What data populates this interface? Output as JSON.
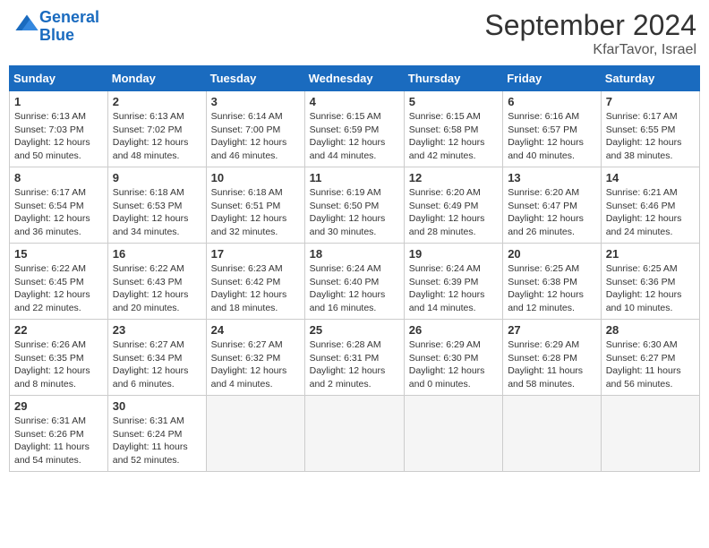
{
  "header": {
    "logo_general": "General",
    "logo_blue": "Blue",
    "title": "September 2024",
    "subtitle": "KfarTavor, Israel"
  },
  "calendar": {
    "days_of_week": [
      "Sunday",
      "Monday",
      "Tuesday",
      "Wednesday",
      "Thursday",
      "Friday",
      "Saturday"
    ],
    "weeks": [
      [
        {
          "day": "1",
          "info": "Sunrise: 6:13 AM\nSunset: 7:03 PM\nDaylight: 12 hours\nand 50 minutes."
        },
        {
          "day": "2",
          "info": "Sunrise: 6:13 AM\nSunset: 7:02 PM\nDaylight: 12 hours\nand 48 minutes."
        },
        {
          "day": "3",
          "info": "Sunrise: 6:14 AM\nSunset: 7:00 PM\nDaylight: 12 hours\nand 46 minutes."
        },
        {
          "day": "4",
          "info": "Sunrise: 6:15 AM\nSunset: 6:59 PM\nDaylight: 12 hours\nand 44 minutes."
        },
        {
          "day": "5",
          "info": "Sunrise: 6:15 AM\nSunset: 6:58 PM\nDaylight: 12 hours\nand 42 minutes."
        },
        {
          "day": "6",
          "info": "Sunrise: 6:16 AM\nSunset: 6:57 PM\nDaylight: 12 hours\nand 40 minutes."
        },
        {
          "day": "7",
          "info": "Sunrise: 6:17 AM\nSunset: 6:55 PM\nDaylight: 12 hours\nand 38 minutes."
        }
      ],
      [
        {
          "day": "8",
          "info": "Sunrise: 6:17 AM\nSunset: 6:54 PM\nDaylight: 12 hours\nand 36 minutes."
        },
        {
          "day": "9",
          "info": "Sunrise: 6:18 AM\nSunset: 6:53 PM\nDaylight: 12 hours\nand 34 minutes."
        },
        {
          "day": "10",
          "info": "Sunrise: 6:18 AM\nSunset: 6:51 PM\nDaylight: 12 hours\nand 32 minutes."
        },
        {
          "day": "11",
          "info": "Sunrise: 6:19 AM\nSunset: 6:50 PM\nDaylight: 12 hours\nand 30 minutes."
        },
        {
          "day": "12",
          "info": "Sunrise: 6:20 AM\nSunset: 6:49 PM\nDaylight: 12 hours\nand 28 minutes."
        },
        {
          "day": "13",
          "info": "Sunrise: 6:20 AM\nSunset: 6:47 PM\nDaylight: 12 hours\nand 26 minutes."
        },
        {
          "day": "14",
          "info": "Sunrise: 6:21 AM\nSunset: 6:46 PM\nDaylight: 12 hours\nand 24 minutes."
        }
      ],
      [
        {
          "day": "15",
          "info": "Sunrise: 6:22 AM\nSunset: 6:45 PM\nDaylight: 12 hours\nand 22 minutes."
        },
        {
          "day": "16",
          "info": "Sunrise: 6:22 AM\nSunset: 6:43 PM\nDaylight: 12 hours\nand 20 minutes."
        },
        {
          "day": "17",
          "info": "Sunrise: 6:23 AM\nSunset: 6:42 PM\nDaylight: 12 hours\nand 18 minutes."
        },
        {
          "day": "18",
          "info": "Sunrise: 6:24 AM\nSunset: 6:40 PM\nDaylight: 12 hours\nand 16 minutes."
        },
        {
          "day": "19",
          "info": "Sunrise: 6:24 AM\nSunset: 6:39 PM\nDaylight: 12 hours\nand 14 minutes."
        },
        {
          "day": "20",
          "info": "Sunrise: 6:25 AM\nSunset: 6:38 PM\nDaylight: 12 hours\nand 12 minutes."
        },
        {
          "day": "21",
          "info": "Sunrise: 6:25 AM\nSunset: 6:36 PM\nDaylight: 12 hours\nand 10 minutes."
        }
      ],
      [
        {
          "day": "22",
          "info": "Sunrise: 6:26 AM\nSunset: 6:35 PM\nDaylight: 12 hours\nand 8 minutes."
        },
        {
          "day": "23",
          "info": "Sunrise: 6:27 AM\nSunset: 6:34 PM\nDaylight: 12 hours\nand 6 minutes."
        },
        {
          "day": "24",
          "info": "Sunrise: 6:27 AM\nSunset: 6:32 PM\nDaylight: 12 hours\nand 4 minutes."
        },
        {
          "day": "25",
          "info": "Sunrise: 6:28 AM\nSunset: 6:31 PM\nDaylight: 12 hours\nand 2 minutes."
        },
        {
          "day": "26",
          "info": "Sunrise: 6:29 AM\nSunset: 6:30 PM\nDaylight: 12 hours\nand 0 minutes."
        },
        {
          "day": "27",
          "info": "Sunrise: 6:29 AM\nSunset: 6:28 PM\nDaylight: 11 hours\nand 58 minutes."
        },
        {
          "day": "28",
          "info": "Sunrise: 6:30 AM\nSunset: 6:27 PM\nDaylight: 11 hours\nand 56 minutes."
        }
      ],
      [
        {
          "day": "29",
          "info": "Sunrise: 6:31 AM\nSunset: 6:26 PM\nDaylight: 11 hours\nand 54 minutes."
        },
        {
          "day": "30",
          "info": "Sunrise: 6:31 AM\nSunset: 6:24 PM\nDaylight: 11 hours\nand 52 minutes."
        },
        {
          "day": "",
          "info": ""
        },
        {
          "day": "",
          "info": ""
        },
        {
          "day": "",
          "info": ""
        },
        {
          "day": "",
          "info": ""
        },
        {
          "day": "",
          "info": ""
        }
      ]
    ]
  }
}
